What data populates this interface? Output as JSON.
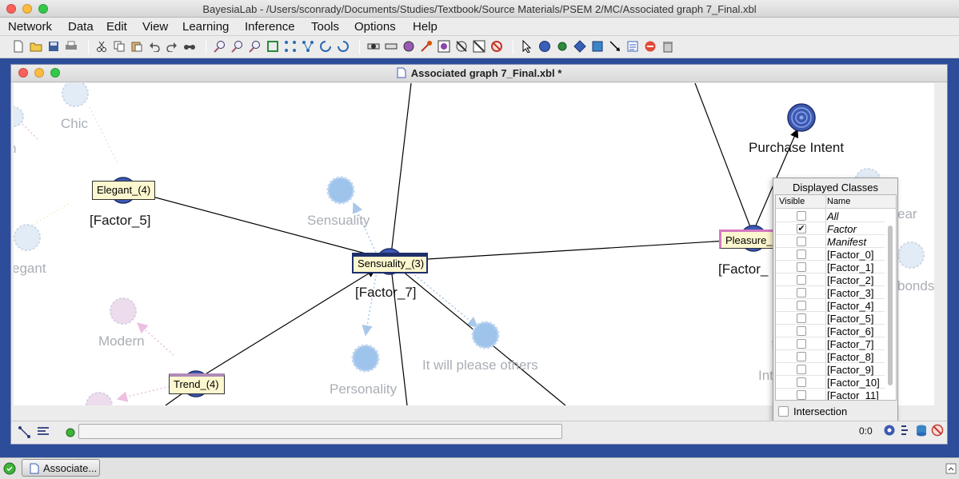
{
  "app": {
    "title": "BayesiaLab - /Users/sconrady/Documents/Studies/Textbook/Source Materials/PSEM 2/MC/Associated graph 7_Final.xbl"
  },
  "menu": [
    "Network",
    "Data",
    "Edit",
    "View",
    "Learning",
    "Inference",
    "Tools",
    "Options",
    "Help"
  ],
  "toolbar_icons": [
    "new-icon",
    "open-icon",
    "save-icon",
    "print-icon",
    "cut-icon",
    "copy-icon",
    "paste-icon",
    "undo-icon",
    "redo-icon",
    "find-icon",
    "zoom-in-icon",
    "zoom-out-icon",
    "zoom-fit-icon",
    "fit-window-icon",
    "distribute-icon",
    "arrange-icon",
    "rotate-left-icon",
    "rotate-right-icon",
    "node-display-icon",
    "edge-display-icon",
    "node-icon",
    "arc-icon",
    "image-icon",
    "hide-icon",
    "filter-icon",
    "delete-arc-icon",
    "pointer-icon",
    "circle-node-icon",
    "constraint-node-icon",
    "decision-node-icon",
    "utility-node-icon",
    "arc-tool-icon",
    "note-icon",
    "stop-icon",
    "trash-icon"
  ],
  "document": {
    "title": "Associated graph 7_Final.xbl *"
  },
  "graph": {
    "faded_labels": {
      "chic": "Chic",
      "sensuality": "Sensuality",
      "elegant": "egant",
      "modern": "Modern",
      "personality": "Personality",
      "please_others": "It will please others",
      "left_edge": "n",
      "right_ar": "ear",
      "right_bonds": "bonds",
      "right_int": "Int"
    },
    "dark_labels": {
      "factor5": "[Factor_5]",
      "factor7": "[Factor_7]",
      "pleasure_factor": "[Factor_",
      "purchase_intent": "Purchase Intent"
    },
    "monitors": {
      "elegant": "Elegant_(4)",
      "sensuality": "Sensuality_(3)",
      "trend": "Trend_(4)",
      "pleasure": "Pleasure_"
    }
  },
  "displayed_classes": {
    "title": "Displayed Classes",
    "col_visible": "Visible",
    "col_name": "Name",
    "rows": [
      {
        "name": "All",
        "checked": false,
        "italic": true
      },
      {
        "name": "Factor",
        "checked": true,
        "italic": true
      },
      {
        "name": "Manifest",
        "checked": false,
        "italic": true
      },
      {
        "name": "[Factor_0]",
        "checked": false,
        "italic": false
      },
      {
        "name": "[Factor_1]",
        "checked": false,
        "italic": false
      },
      {
        "name": "[Factor_2]",
        "checked": false,
        "italic": false
      },
      {
        "name": "[Factor_3]",
        "checked": false,
        "italic": false
      },
      {
        "name": "[Factor_4]",
        "checked": false,
        "italic": false
      },
      {
        "name": "[Factor_5]",
        "checked": false,
        "italic": false
      },
      {
        "name": "[Factor_6]",
        "checked": false,
        "italic": false
      },
      {
        "name": "[Factor_7]",
        "checked": false,
        "italic": false
      },
      {
        "name": "[Factor_8]",
        "checked": false,
        "italic": false
      },
      {
        "name": "[Factor_9]",
        "checked": false,
        "italic": false
      },
      {
        "name": "[Factor_10]",
        "checked": false,
        "italic": false
      },
      {
        "name": "[Factor_11]",
        "checked": false,
        "italic": false
      }
    ],
    "intersection_label": "Intersection"
  },
  "status": {
    "coord": "0:0"
  },
  "taskbar": {
    "item": "Associate..."
  }
}
